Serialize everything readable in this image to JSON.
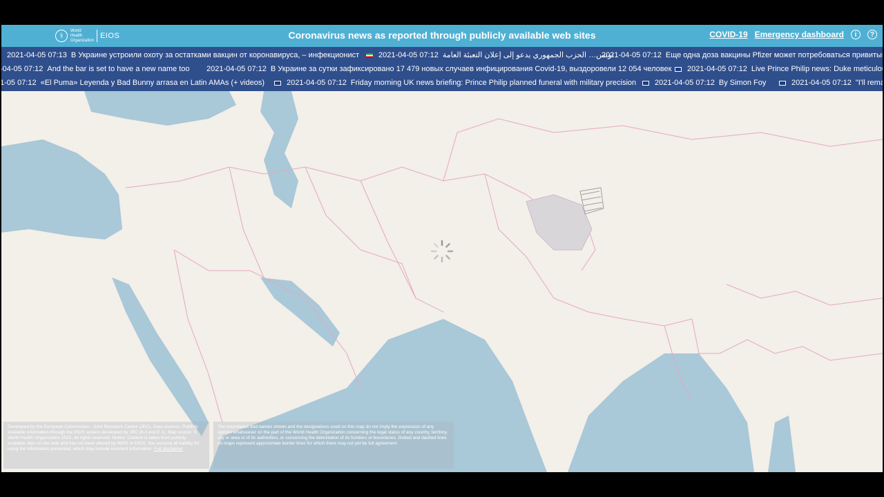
{
  "header": {
    "logo_org": "World Health Organization",
    "logo_eios": "EIOS",
    "title": "Coronavirus news as reported through publicly available web sites",
    "nav_covid": "COVID-19",
    "nav_dashboard": "Emergency dashboard",
    "icons": [
      "info-icon",
      "help-icon"
    ]
  },
  "ticker": {
    "row0": [
      {
        "ts": "2021-04-05 07:13",
        "text": "В Украине устроили охоту за остатками вакцин от коронавируса, – инфекционист",
        "flag": "none"
      },
      {
        "ts": "2021-04-05 07:12",
        "text": "تونس… الحزب الجمهوري يدعو إلى إعلان التعبئة العامة",
        "flag": "iran"
      },
      {
        "ts": "2021-04-05 07:12",
        "text": "Еще одна доза вакцины Pfizer может потребоваться привитым",
        "flag": "none"
      }
    ],
    "row1": [
      {
        "ts": "-04-05 07:12",
        "text": "And the bar is set to have a new name too",
        "flag": "none"
      },
      {
        "ts": "2021-04-05 07:12",
        "text": "В Украине за сутки зафиксировано 17 479 новых случаев инфицирования Covid-19, выздоровели 12 054 человек",
        "flag": "none"
      },
      {
        "ts": "2021-04-05 07:12",
        "text": "Live Prince Philip news: Duke meticulous",
        "flag": "uk"
      }
    ],
    "row2": [
      {
        "ts": "1-05 07:12",
        "text": "«El Puma» Leyenda y Bad Bunny arrasa en Latin AMAs (+ videos)",
        "flag": "none"
      },
      {
        "ts": "2021-04-05 07:12",
        "text": "Friday morning UK news briefing: Prince Philip planned funeral with military precision",
        "flag": "uk"
      },
      {
        "ts": "2021-04-05 07:12",
        "text": "By Simon Foy",
        "flag": "uk"
      },
      {
        "ts": "2021-04-05 07:12",
        "text": "\"I'll remai",
        "flag": "uk"
      }
    ]
  },
  "notes": {
    "left_text": "Developed by the European Commission - Joint Research Centre (JRC). Data sources: Publicly available information through the EIOS system developed by JRC (6.3 and E.1). Map source: © World Health Organization 2020, All rights reserved. Notice: Content is taken from publicly available sites on the web and has not been altered by WHO or EIOS. You assume all liability for using the information presented, which may include incorrect information.",
    "left_link": "Full disclaimer",
    "right_text": "The boundaries and names shown and the designations used on this map do not imply the expression of any opinion whatsoever on the part of the World Health Organization concerning the legal status of any country, territory, city or area or of its authorities, or concerning the delimitation of its frontiers or boundaries. Dotted and dashed lines on maps represent approximate border lines for which there may not yet be full agreement."
  },
  "colors": {
    "header": "#4fb0d4",
    "ticker": "#2f4e8c",
    "land": "#f3efe9",
    "water": "#a9c8d8",
    "border": "#e3a9bf",
    "disputed": "#d9d6d9"
  }
}
